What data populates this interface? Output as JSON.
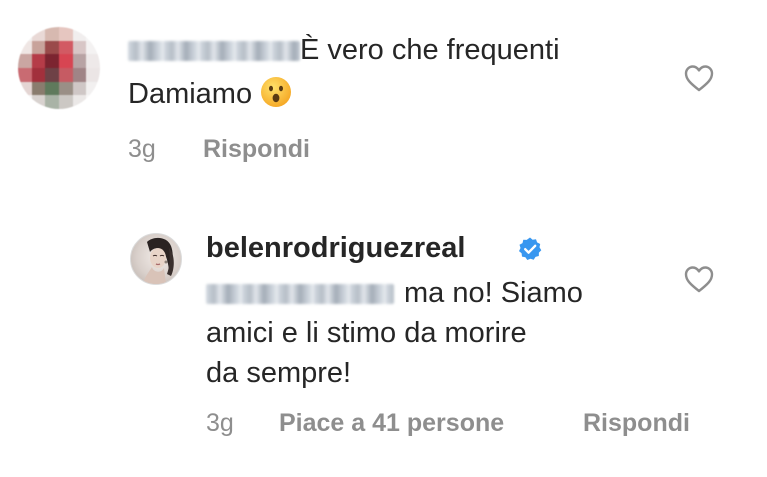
{
  "comments": [
    {
      "text_line1": "È vero che frequenti",
      "text_line2": "Damiamo",
      "emoji_icon": "astonished-face-emoji",
      "time": "3g",
      "reply_label": "Rispondi"
    },
    {
      "username": "belenrodriguezreal",
      "verified_icon": "verified-badge-icon",
      "text_line1": "ma no! Siamo",
      "text_line2": "amici e li stimo da morire",
      "text_line3": "da sempre!",
      "time": "3g",
      "likes_label": "Piace a 41 persone",
      "reply_label": "Rispondi"
    }
  ],
  "colors": {
    "text": "#262626",
    "meta": "#8e8e8e",
    "verified": "#3897f0",
    "heart_outline": "#8e8e8e"
  }
}
